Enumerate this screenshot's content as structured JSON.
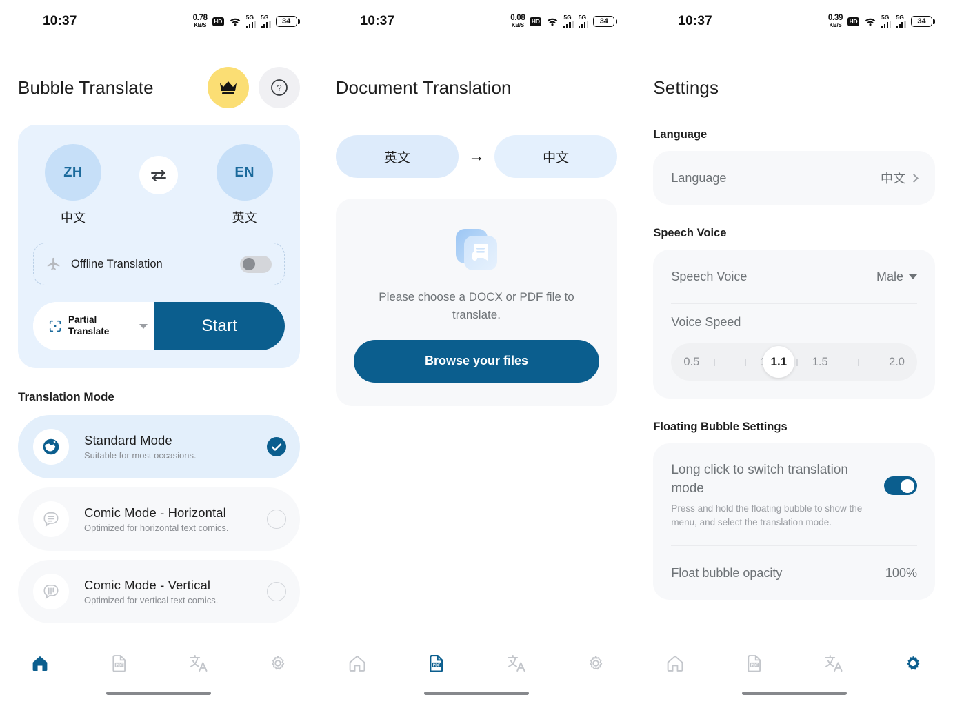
{
  "screens": [
    {
      "statusbar": {
        "time": "10:37",
        "net_speed": "0.78",
        "net_unit": "KB/S",
        "hd_badge": "HD",
        "signal_gen": "5G",
        "battery": "34"
      },
      "header": {
        "title": "Bubble Translate",
        "crown_icon": "crown-icon",
        "help_icon": "help-circle-icon"
      },
      "translate_card": {
        "source": {
          "code": "ZH",
          "name": "中文"
        },
        "target": {
          "code": "EN",
          "name": "英文"
        },
        "swap_icon": "swap-horizontal-icon",
        "offline": {
          "label": "Offline Translation",
          "icon": "airplane-icon",
          "enabled": false
        },
        "mode_select": {
          "label_line1": "Partial",
          "label_line2": "Translate",
          "icon": "crop-focus-icon"
        },
        "start_label": "Start"
      },
      "mode_section": {
        "title": "Translation Mode",
        "items": [
          {
            "name": "Standard Mode",
            "desc": "Suitable for most occasions.",
            "icon": "globe-icon",
            "selected": true
          },
          {
            "name": "Comic Mode - Horizontal",
            "desc": "Optimized for horizontal text comics.",
            "icon": "speech-bubble-lines-icon",
            "selected": false
          },
          {
            "name": "Comic Mode - Vertical",
            "desc": "Optimized for vertical text comics.",
            "icon": "speech-bubble-vertical-icon",
            "selected": false
          }
        ]
      },
      "nav": {
        "active": 0,
        "items": [
          {
            "label": "home",
            "icon": "home-icon"
          },
          {
            "label": "document",
            "icon": "pdf-file-icon"
          },
          {
            "label": "translate",
            "icon": "translate-icon"
          },
          {
            "label": "settings",
            "icon": "gear-icon"
          }
        ]
      }
    },
    {
      "statusbar": {
        "time": "10:37",
        "net_speed": "0.08",
        "net_unit": "KB/S",
        "hd_badge": "HD",
        "signal_gen": "5G",
        "battery": "34"
      },
      "header": {
        "title": "Document Translation"
      },
      "doc": {
        "source_lang": "英文",
        "arrow": "→",
        "target_lang": "中文",
        "file_icon": "documents-stack-icon",
        "hint": "Please choose a DOCX or PDF file to translate.",
        "browse_label": "Browse your files"
      },
      "nav": {
        "active": 1,
        "items": [
          {
            "label": "home",
            "icon": "home-icon"
          },
          {
            "label": "document",
            "icon": "pdf-file-icon"
          },
          {
            "label": "translate",
            "icon": "translate-icon"
          },
          {
            "label": "settings",
            "icon": "gear-icon"
          }
        ]
      }
    },
    {
      "statusbar": {
        "time": "10:37",
        "net_speed": "0.39",
        "net_unit": "KB/S",
        "hd_badge": "HD",
        "signal_gen": "5G",
        "battery": "34"
      },
      "header": {
        "title": "Settings"
      },
      "settings": {
        "language_section": {
          "title": "Language",
          "row_label": "Language",
          "value": "中文",
          "chevron_icon": "chevron-right-icon"
        },
        "speech_section": {
          "title": "Speech Voice",
          "voice_label": "Speech Voice",
          "voice_value": "Male",
          "voice_caret_icon": "chevron-down-icon",
          "speed_label": "Voice Speed",
          "speed_min": "0.5",
          "speed_mid_low": "1",
          "speed_value": "1.1",
          "speed_mid_high": "1.5",
          "speed_max": "2.0"
        },
        "bubble_section": {
          "title": "Floating Bubble Settings",
          "long_click_title": "Long click to switch translation mode",
          "long_click_desc": "Press and hold the floating bubble to show the menu, and select the translation mode.",
          "long_click_enabled": true,
          "opacity_label": "Float bubble opacity",
          "opacity_value": "100%"
        }
      },
      "nav": {
        "active": 3,
        "items": [
          {
            "label": "home",
            "icon": "home-icon"
          },
          {
            "label": "document",
            "icon": "pdf-file-icon"
          },
          {
            "label": "translate",
            "icon": "translate-icon"
          },
          {
            "label": "settings",
            "icon": "gear-icon"
          }
        ]
      }
    }
  ],
  "colors": {
    "accent": "#0B5E8E",
    "card_blue": "#E8F2FD",
    "lang_circle": "#C6DFF8",
    "crown_bg": "#FBDE74",
    "card_gray": "#F7F8FA",
    "muted_text": "#8A8D92"
  }
}
